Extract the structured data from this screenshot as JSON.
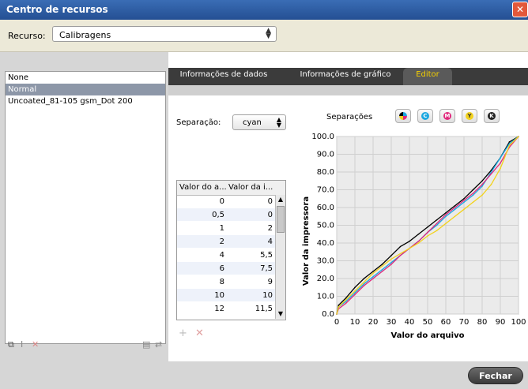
{
  "window": {
    "title": "Centro de recursos"
  },
  "resource": {
    "label": "Recurso:",
    "value": "Calibragens"
  },
  "calibrations": [
    "None",
    "Normal",
    "Uncoated_81-105 gsm_Dot 200"
  ],
  "tabs": [
    "Informações de dados",
    "Informações de gráfico",
    "Editor"
  ],
  "separation": {
    "label": "Separação:",
    "value": "cyan"
  },
  "separations_header": "Separações",
  "separation_chips": [
    {
      "name": "all-separations",
      "color": "#000000"
    },
    {
      "name": "cyan",
      "letter": "C",
      "color": "#1aa7e0"
    },
    {
      "name": "magenta",
      "letter": "M",
      "color": "#e0287c"
    },
    {
      "name": "yellow",
      "letter": "Y",
      "color": "#f2d21c"
    },
    {
      "name": "black",
      "letter": "K",
      "color": "#222222"
    }
  ],
  "table": {
    "headers": [
      "Valor do a...",
      "Valor da i..."
    ],
    "rows": [
      [
        "0",
        "0"
      ],
      [
        "0,5",
        "0"
      ],
      [
        "1",
        "2"
      ],
      [
        "2",
        "4"
      ],
      [
        "4",
        "5,5"
      ],
      [
        "6",
        "7,5"
      ],
      [
        "8",
        "9"
      ],
      [
        "10",
        "10"
      ],
      [
        "12",
        "11,5"
      ]
    ]
  },
  "chart_data": {
    "type": "line",
    "xlabel": "Valor do arquivo",
    "ylabel": "Valor da impressora",
    "xlim": [
      0,
      100
    ],
    "ylim": [
      0,
      100
    ],
    "x_ticks": [
      "0",
      "10",
      "20",
      "30",
      "40",
      "50",
      "60",
      "70",
      "80",
      "90",
      "100"
    ],
    "y_ticks": [
      "0.0",
      "10.0",
      "20.0",
      "30.0",
      "40.0",
      "50.0",
      "60.0",
      "70.0",
      "80.0",
      "90.0",
      "100.0"
    ],
    "grid": true,
    "x": [
      0,
      1,
      5,
      10,
      15,
      20,
      25,
      30,
      35,
      40,
      45,
      50,
      55,
      60,
      65,
      70,
      75,
      80,
      85,
      90,
      95,
      100
    ],
    "series": [
      {
        "color": "#000000",
        "values": [
          0,
          5,
          9,
          15,
          20,
          24,
          28,
          33,
          38,
          41,
          45,
          49,
          53,
          57,
          61,
          65,
          70,
          75,
          81,
          88,
          97,
          100
        ]
      },
      {
        "color": "#1aa7e0",
        "values": [
          0,
          4,
          7,
          12,
          17,
          21,
          25,
          29,
          33,
          37,
          41,
          46,
          50,
          55,
          59,
          63,
          67,
          72,
          80,
          88,
          96,
          100
        ]
      },
      {
        "color": "#e0287c",
        "values": [
          0,
          3,
          6,
          11,
          16,
          20,
          24,
          28,
          33,
          37,
          41,
          46,
          51,
          56,
          60,
          64,
          68,
          73,
          79,
          85,
          94,
          100
        ]
      },
      {
        "color": "#f2d21c",
        "values": [
          0,
          4,
          8,
          13,
          18,
          23,
          27,
          31,
          34,
          37,
          40,
          44,
          47,
          51,
          55,
          59,
          63,
          67,
          73,
          82,
          95,
          100
        ]
      }
    ]
  },
  "footer": {
    "close_label": "Fechar"
  }
}
